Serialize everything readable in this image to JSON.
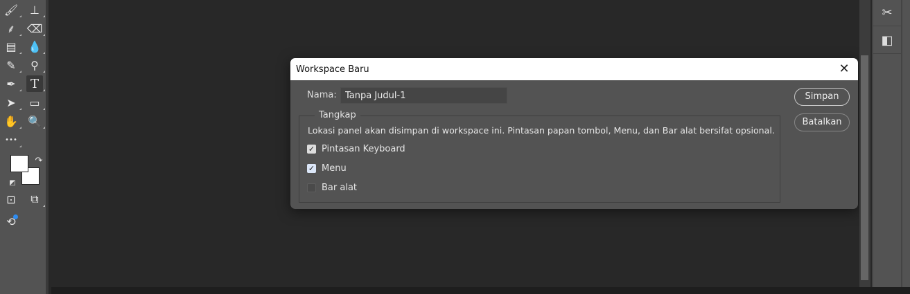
{
  "toolbar": {
    "tools": [
      {
        "name": "brush-tool",
        "glyph": "🖌"
      },
      {
        "name": "clone-stamp-tool",
        "glyph": "⊥"
      },
      {
        "name": "history-brush-tool",
        "glyph": "⸙"
      },
      {
        "name": "eraser-tool",
        "glyph": "⌫"
      },
      {
        "name": "gradient-tool",
        "glyph": "▤"
      },
      {
        "name": "blur-tool",
        "glyph": "💧"
      },
      {
        "name": "mixer-brush-tool",
        "glyph": "✎"
      },
      {
        "name": "dodge-tool",
        "glyph": "⚲"
      },
      {
        "name": "pen-tool",
        "glyph": "✒"
      },
      {
        "name": "type-tool",
        "glyph": "T"
      },
      {
        "name": "path-selection-tool",
        "glyph": "➤"
      },
      {
        "name": "rectangle-tool",
        "glyph": "▭"
      },
      {
        "name": "hand-tool",
        "glyph": "✋"
      },
      {
        "name": "zoom-tool",
        "glyph": "🔍"
      },
      {
        "name": "more-tools",
        "glyph": "•••"
      }
    ]
  },
  "dialog": {
    "title": "Workspace Baru",
    "close_glyph": "✕",
    "name_label": "Nama:",
    "name_value": "Tanpa Judul-1",
    "group_title": "Tangkap",
    "description": "Lokasi panel akan disimpan di workspace ini. Pintasan papan tombol, Menu, dan Bar alat bersifat opsional.",
    "options": [
      {
        "label": "Pintasan Keyboard",
        "checked": true
      },
      {
        "label": "Menu",
        "checked": true
      },
      {
        "label": "Bar alat",
        "checked": false
      }
    ],
    "save_label": "Simpan",
    "cancel_label": "Batalkan"
  }
}
